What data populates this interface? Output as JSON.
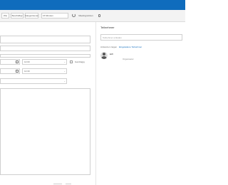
{
  "window": {
    "title": ""
  },
  "toolbar": {
    "btn_1": "Wie",
    "btn_2": "Beschäftigt",
    "btn_3": "Kategorisieren",
    "reminder": "15 Minuten",
    "meeting": "Meetingnotizen"
  },
  "form": {
    "start_time": "12:00",
    "end_time": "12:30",
    "all_day_label": "Ganztägig"
  },
  "attendees": {
    "title": "Teilnehmer",
    "search_placeholder": "Teilnehmer einladen",
    "response_label": "Antworten zeigen",
    "response_value": "Eingeladene Teilnehmer",
    "person_initials": "EW",
    "person_role": "Organisator"
  },
  "colors": {
    "title_bar": "#0f6cbd",
    "toolbar_bg": "#f3f3f3",
    "link": "#0f6cbd"
  }
}
